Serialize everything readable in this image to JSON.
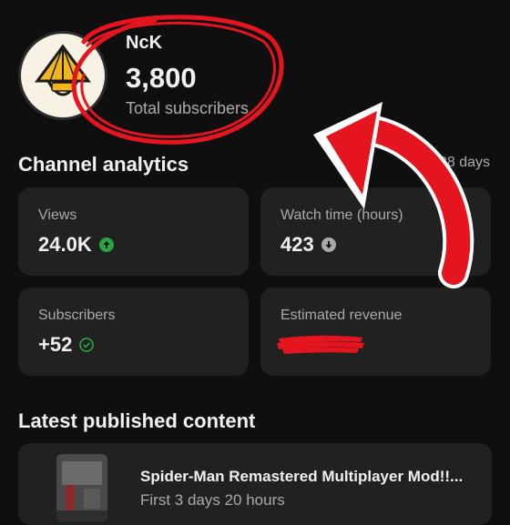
{
  "channel": {
    "name": "NcK",
    "subscriber_count": "3,800",
    "subscriber_label": "Total subscribers"
  },
  "analytics": {
    "title": "Channel analytics",
    "period": "ast 28 days",
    "cards": [
      {
        "label": "Views",
        "value": "24.0K",
        "trend": "up"
      },
      {
        "label": "Watch time (hours)",
        "value": "423",
        "trend": "down"
      },
      {
        "label": "Subscribers",
        "value": "+52",
        "trend": "check"
      },
      {
        "label": "Estimated revenue",
        "value": "",
        "redacted": true
      }
    ]
  },
  "latest": {
    "title": "Latest published content",
    "item": {
      "title": "Spider-Man Remastered Multiplayer Mod!!...",
      "subtitle": "First 3 days 20 hours"
    }
  },
  "colors": {
    "background": "#0f0f0f",
    "card": "#212121",
    "trend_up": "#2ba640",
    "annotation": "#e4151f"
  }
}
